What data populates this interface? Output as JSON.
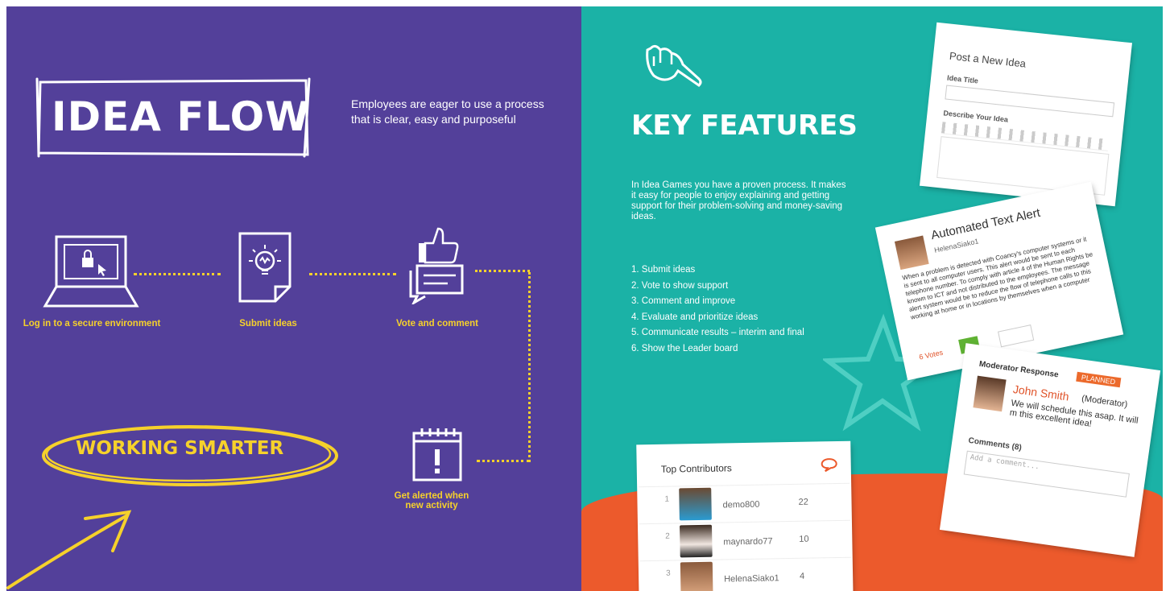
{
  "left": {
    "title": "IDEA FLOW",
    "tagline": "Employees are eager to use a process that is clear, easy and purposeful",
    "steps": [
      {
        "label": "Log in to a secure environment"
      },
      {
        "label": "Submit ideas"
      },
      {
        "label": "Vote and comment"
      },
      {
        "label": "Get alerted when new activity"
      }
    ],
    "slogan": "WORKING SMARTER"
  },
  "right": {
    "title": "KEY FEATURES",
    "intro": "In Idea Games you have a proven process. It makes it easy for people to enjoy explaining and getting support for their problem-solving and money-saving ideas.",
    "features": [
      "1. Submit ideas",
      "2. Vote to show support",
      "3. Comment and improve",
      "4. Evaluate and prioritize ideas",
      "5. Communicate results – interim and final",
      "6. Show the Leader board"
    ]
  },
  "cards": {
    "post": {
      "title": "Post a New Idea",
      "idea_title_label": "Idea Title",
      "describe_label": "Describe Your Idea"
    },
    "alert": {
      "title": "Automated Text Alert",
      "author": "HelenaSiako1",
      "body": "When a problem is detected with Coancy's computer systems or it is sent to all computer users. This alert would be sent to each telephone number. To comply with article 4 of the Human Rights be known to ICT and not distributed to the employees. The message alert system would be to reduce the flow of telephone calls to this working at home or in locations by themselves when a computer",
      "votes": "6 Votes"
    },
    "moderator": {
      "header": "Moderator Response",
      "status": "PLANNED",
      "name": "John Smith",
      "role": "(Moderator)",
      "message": "We will schedule this asap. It will m this excellent idea!",
      "comments_label": "Comments (8)",
      "comment_placeholder": "Add a comment..."
    },
    "contributors": {
      "title": "Top Contributors",
      "rows": [
        {
          "rank": "1",
          "name": "demo800",
          "count": "22"
        },
        {
          "rank": "2",
          "name": "maynardo77",
          "count": "10"
        },
        {
          "rank": "3",
          "name": "HelenaSiako1",
          "count": "4"
        }
      ]
    }
  },
  "colors": {
    "purple": "#53409a",
    "teal": "#1bb2a6",
    "orange": "#ec5a2c",
    "yellow": "#f6d12b"
  }
}
